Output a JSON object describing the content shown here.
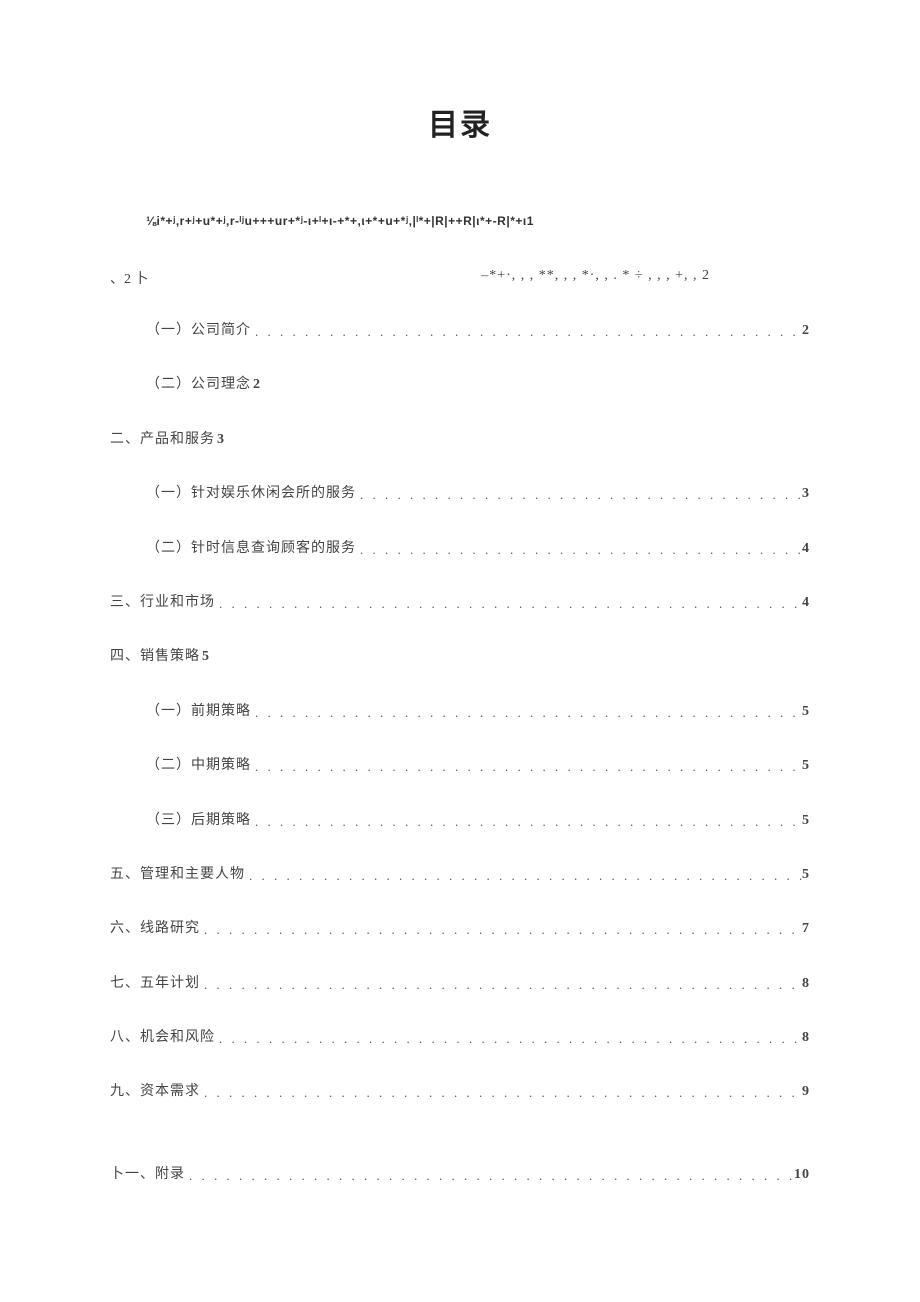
{
  "title": "目录",
  "garble_line": "⅛i*+ʲ,r+ʲ+u*+ʲ,r-ˡʲu+++ur+*ʲ-ι+ˡ+ι-+*+,ι+*+u+*ʲ,|ˡ*+|R|++R|ι*+-R|*+ι1",
  "split": {
    "left": "、2 卜",
    "right": "–*+·, , , **, , , *·, , . * ÷ , , , +, , 2"
  },
  "toc": [
    {
      "indent": 1,
      "label": "（一）公司简介",
      "page": "2",
      "leader": true
    },
    {
      "indent": 1,
      "label": "（二）公司理念",
      "page": "2",
      "leader": false
    },
    {
      "indent": 0,
      "label": "二、产品和服务",
      "page": "3",
      "leader": false
    },
    {
      "indent": 1,
      "label": "（一）针对娱乐休闲会所的服务",
      "page": "3",
      "leader": true
    },
    {
      "indent": 1,
      "label": "（二）针时信息查询顾客的服务",
      "page": "4",
      "leader": true
    },
    {
      "indent": 0,
      "label": "三、行业和市场",
      "page": "4",
      "leader": true
    },
    {
      "indent": 0,
      "label": "四、销售策略",
      "page": "5",
      "leader": false
    },
    {
      "indent": 1,
      "label": "（一）前期策略",
      "page": "5",
      "leader": true
    },
    {
      "indent": 1,
      "label": "（二）中期策略",
      "page": "5",
      "leader": true
    },
    {
      "indent": 1,
      "label": "（三）后期策略",
      "page": "5",
      "leader": true
    },
    {
      "indent": 0,
      "label": "五、管理和主要人物",
      "page": "5",
      "leader": true
    },
    {
      "indent": 0,
      "label": "六、线路研究",
      "page": "7",
      "leader": true
    },
    {
      "indent": 0,
      "label": "七、五年计划",
      "page": "8",
      "leader": true
    },
    {
      "indent": 0,
      "label": "八、机会和风险",
      "page": "8",
      "leader": true
    },
    {
      "indent": 0,
      "label": "九、资本需求",
      "page": "9",
      "leader": true
    },
    {
      "indent": 0,
      "label": "卜一、附录",
      "page": "10",
      "leader": true,
      "gap": true
    }
  ],
  "leader_dots": ". . . . . . . . . . . . . . . . . . . . . . . . . . . . . . . . . . . . . . . . . . . . . . . . . . . . . . . . . . . . . . . . . . . . . . . . . . . . . . . . . . . . . . . ."
}
